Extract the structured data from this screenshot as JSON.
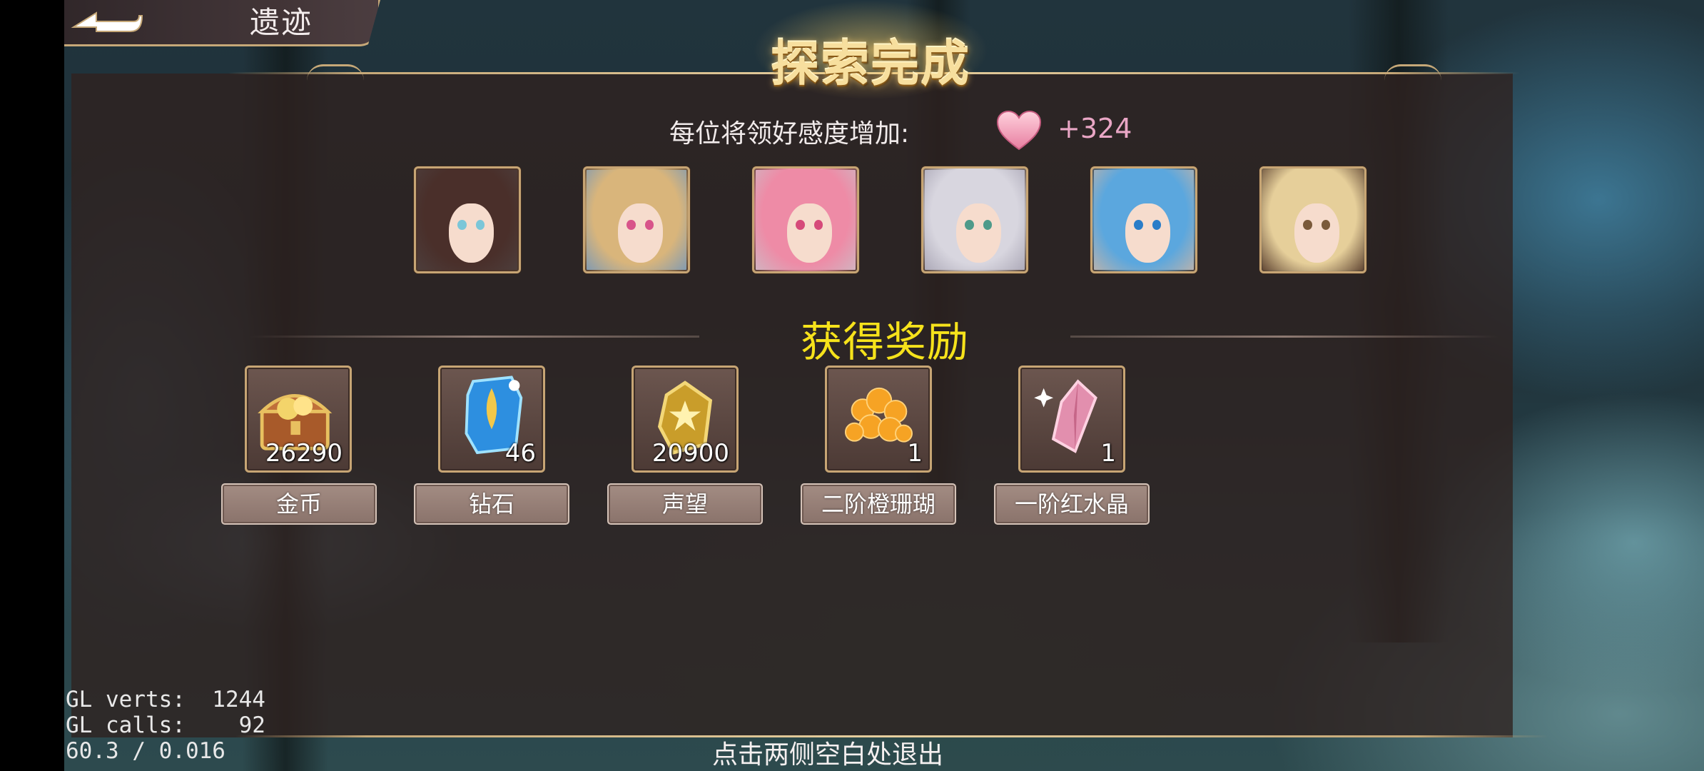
{
  "header": {
    "back_icon": "back-arrow-icon",
    "title": "遗迹"
  },
  "banner": {
    "title": "探索完成"
  },
  "affection": {
    "label": "每位将领好感度增加:",
    "icon": "heart-icon",
    "value": "+324",
    "value_color": "#e9a6c5"
  },
  "portraits": [
    {
      "name": "portrait-1",
      "hair": "#4a2f2a",
      "eye": "#7bc6d8"
    },
    {
      "name": "portrait-2",
      "hair": "#d9b57b",
      "eye": "#d8548a"
    },
    {
      "name": "portrait-3",
      "hair": "#ee8ba6",
      "eye": "#d64a7a"
    },
    {
      "name": "portrait-4",
      "hair": "#d8d6df",
      "eye": "#4e9a8a"
    },
    {
      "name": "portrait-5",
      "hair": "#5ba7de",
      "eye": "#2a7dc8"
    },
    {
      "name": "portrait-6",
      "hair": "#e6cf9a",
      "eye": "#7a5a3a"
    }
  ],
  "rewards": {
    "title": "获得奖励",
    "title_color": "#f6e21b",
    "items": [
      {
        "icon": "treasure-chest-icon",
        "count": "26290",
        "label": "金币"
      },
      {
        "icon": "diamond-icon",
        "count": "46",
        "label": "钻石"
      },
      {
        "icon": "reputation-medal-icon",
        "count": "20900",
        "label": "声望"
      },
      {
        "icon": "orange-coral-icon",
        "count": "1",
        "label": "二阶橙珊瑚"
      },
      {
        "icon": "red-crystal-icon",
        "count": "1",
        "label": "一阶红水晶"
      }
    ]
  },
  "footer": {
    "exit_hint": "点击两侧空白处退出"
  },
  "debug": {
    "line1": "GL verts:  1244",
    "line2": "GL calls:    92",
    "line3": "60.3 / 0.016"
  }
}
